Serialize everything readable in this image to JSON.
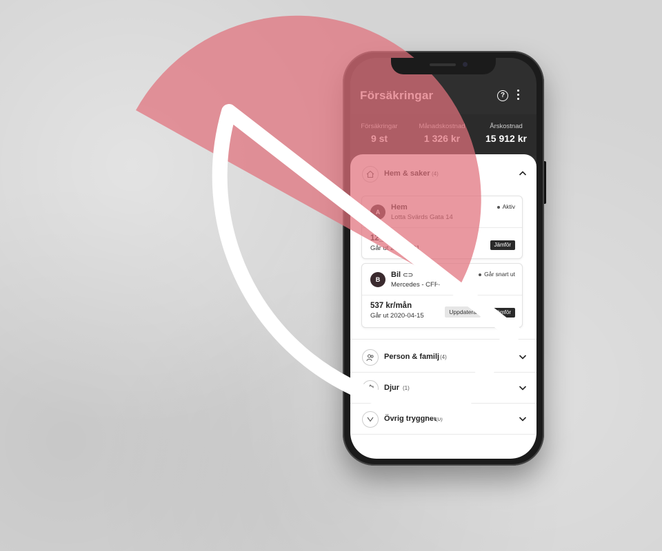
{
  "app": {
    "title": "Försäkringar"
  },
  "summary": {
    "stats": [
      {
        "label": "Försäkringar",
        "value": "9 st"
      },
      {
        "label": "Månadskostnad",
        "value": "1 326 kr"
      },
      {
        "label": "Årskostnad",
        "value": "15 912 kr"
      }
    ]
  },
  "categories": [
    {
      "label": "Hem & saker",
      "count": "(4)",
      "icon": "home-icon",
      "expanded": true
    },
    {
      "label": "Person & familj",
      "count": "(4)",
      "icon": "people-icon",
      "expanded": false
    },
    {
      "label": "Djur",
      "count": "(1)",
      "icon": "pet-icon",
      "expanded": false
    },
    {
      "label": "Övrig trygghet",
      "count": "(0)",
      "icon": "shield-icon",
      "expanded": false
    }
  ],
  "cards": [
    {
      "avatar": "A",
      "name": "Hem",
      "address": "Lotta Svärds Gata 14",
      "status": "Aktiv",
      "price": "12_ _ån",
      "expiry": "Går ut 20_ _1-31",
      "compare_label": "Jämför"
    },
    {
      "avatar": "B",
      "name": "Bil",
      "address": "Mercedes - CFF-",
      "status": "Går snart ut",
      "price": "537 kr/mån",
      "expiry": "Går ut 2020-04-15",
      "update_label": "Uppdatera",
      "compare_label": "Jämför"
    }
  ],
  "colors": {
    "accent": "#e07b86",
    "dark": "#2f2f2f",
    "background": "#d4d4d4"
  }
}
